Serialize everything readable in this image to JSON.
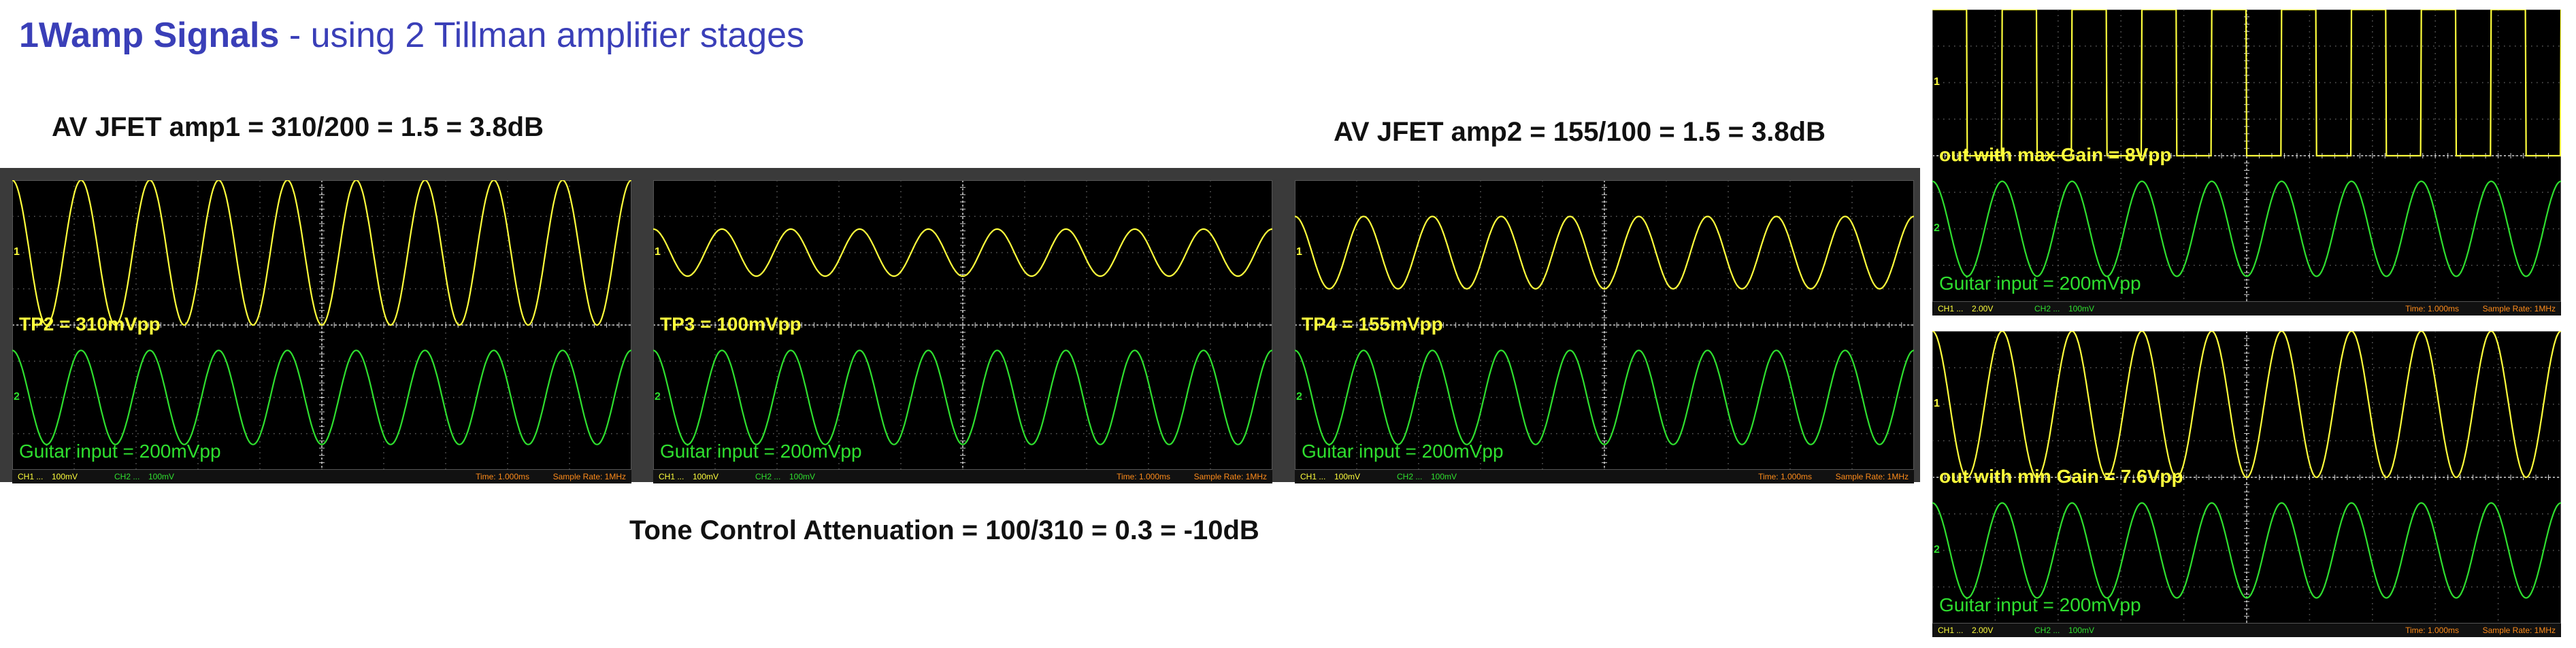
{
  "title": {
    "bold": "1Wamp Signals",
    "rest": " - using 2 Tillman amplifier stages"
  },
  "headings": {
    "amp1": "AV JFET amp1 = 310/200 = 1.5 = 3.8dB",
    "amp2": "AV JFET amp2 = 155/100 = 1.5 = 3.8dB",
    "tone": "Tone Control Attenuation = 100/310 = 0.3 = -10dB"
  },
  "colors": {
    "ch1": "#ffff3c",
    "ch2": "#2fe02f",
    "time": "#ff8c1a",
    "grid": "#9a9a9a",
    "screen": "#000000",
    "title": "#3a3fb8"
  },
  "scopes": [
    {
      "id": "tp2",
      "caption": "TP2 = 310mVpp",
      "input_caption": "Guitar input = 200mVpp",
      "ch1_label": "CH1 ...",
      "ch1_scale": "100mV",
      "ch2_label": "CH2 ...",
      "ch2_scale": "100mV",
      "time": "Time: 1.000ms",
      "rate": "Sample Rate: 1MHz",
      "ch1_shape": "sine",
      "ch1_cycles": 9,
      "ch1_amp_div": 2.0,
      "ch2_cycles": 9,
      "ch2_amp_div": 1.3
    },
    {
      "id": "tp3",
      "caption": "TP3 = 100mVpp",
      "input_caption": "Guitar input = 200mVpp",
      "ch1_label": "CH1 ...",
      "ch1_scale": "100mV",
      "ch2_label": "CH2 ...",
      "ch2_scale": "100mV",
      "time": "Time: 1.000ms",
      "rate": "Sample Rate: 1MHz",
      "ch1_shape": "sine",
      "ch1_cycles": 9,
      "ch1_amp_div": 0.65,
      "ch2_cycles": 9,
      "ch2_amp_div": 1.3
    },
    {
      "id": "tp4",
      "caption": "TP4 = 155mVpp",
      "input_caption": "Guitar input = 200mVpp",
      "ch1_label": "CH1 ...",
      "ch1_scale": "100mV",
      "ch2_label": "CH2 ...",
      "ch2_scale": "100mV",
      "time": "Time: 1.000ms",
      "rate": "Sample Rate: 1MHz",
      "ch1_shape": "sine",
      "ch1_cycles": 9,
      "ch1_amp_div": 1.0,
      "ch2_cycles": 9,
      "ch2_amp_div": 1.3
    },
    {
      "id": "max",
      "caption": "out with max Gain = 8Vpp",
      "input_caption": "Guitar input = 200mVpp",
      "ch1_label": "CH1 ...",
      "ch1_scale": "2.00V",
      "ch2_label": "CH2 ...",
      "ch2_scale": "100mV",
      "time": "Time: 1.000ms",
      "rate": "Sample Rate: 1MHz",
      "ch1_shape": "square",
      "ch1_cycles": 9,
      "ch1_amp_div": 2.0,
      "ch2_cycles": 9,
      "ch2_amp_div": 1.3
    },
    {
      "id": "min",
      "caption": "out with min Gain = 7.6Vpp",
      "input_caption": "Guitar input = 200mVpp",
      "ch1_label": "CH1 ...",
      "ch1_scale": "2.00V",
      "ch2_label": "CH2 ...",
      "ch2_scale": "100mV",
      "time": "Time: 1.000ms",
      "rate": "Sample Rate: 1MHz",
      "ch1_shape": "sine",
      "ch1_cycles": 9,
      "ch1_amp_div": 2.0,
      "ch2_cycles": 9,
      "ch2_amp_div": 1.3
    }
  ]
}
